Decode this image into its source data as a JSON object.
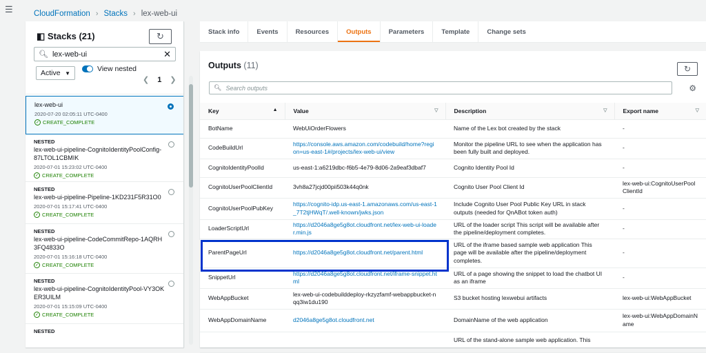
{
  "breadcrumb": [
    "CloudFormation",
    "Stacks",
    "lex-web-ui"
  ],
  "stacks_panel": {
    "title": "Stacks",
    "count": "(21)",
    "search_value": "lex-web-ui",
    "filter_value": "Active",
    "view_nested_label": "View nested",
    "page": "1",
    "items": [
      {
        "nested": "",
        "name": "lex-web-ui",
        "date": "2020-07-20 02:05:11 UTC-0400",
        "status": "CREATE_COMPLETE",
        "selected": true
      },
      {
        "nested": "NESTED",
        "name": "lex-web-ui-pipeline-CognitoIdentityPoolConfig-87LTOL1CBMIK",
        "date": "2020-07-01 15:23:02 UTC-0400",
        "status": "CREATE_COMPLETE",
        "selected": false
      },
      {
        "nested": "NESTED",
        "name": "lex-web-ui-pipeline-Pipeline-1KD231F5R31O0",
        "date": "2020-07-01 15:17:41 UTC-0400",
        "status": "CREATE_COMPLETE",
        "selected": false
      },
      {
        "nested": "NESTED",
        "name": "lex-web-ui-pipeline-CodeCommitRepo-1AQRH3FQ4833O",
        "date": "2020-07-01 15:16:18 UTC-0400",
        "status": "CREATE_COMPLETE",
        "selected": false
      },
      {
        "nested": "NESTED",
        "name": "lex-web-ui-pipeline-CognitoIdentityPool-VY3OKER3UILM",
        "date": "2020-07-01 15:15:09 UTC-0400",
        "status": "CREATE_COMPLETE",
        "selected": false
      },
      {
        "nested": "NESTED",
        "name": "",
        "date": "",
        "status": "",
        "selected": false
      }
    ]
  },
  "tabs": [
    {
      "label": "Stack info",
      "active": false
    },
    {
      "label": "Events",
      "active": false
    },
    {
      "label": "Resources",
      "active": false
    },
    {
      "label": "Outputs",
      "active": true
    },
    {
      "label": "Parameters",
      "active": false
    },
    {
      "label": "Template",
      "active": false
    },
    {
      "label": "Change sets",
      "active": false
    }
  ],
  "outputs": {
    "title": "Outputs",
    "count": "(11)",
    "search_placeholder": "Search outputs",
    "columns": [
      "Key",
      "Value",
      "Description",
      "Export name"
    ],
    "rows": [
      {
        "key": "BotName",
        "value": "WebUiOrderFlowers",
        "link": false,
        "description": "Name of the Lex bot created by the stack",
        "export": "-"
      },
      {
        "key": "CodeBuildUrl",
        "value": "https://console.aws.amazon.com/codebuild/home?region=us-east-1#/projects/lex-web-ui/view",
        "link": true,
        "description": "Monitor the pipeline URL to see when the application has been fully built and deployed.",
        "export": "-"
      },
      {
        "key": "CognitoIdentityPoolId",
        "value": "us-east-1:a6219dbc-f6b5-4e79-8d06-2a9eaf3dbaf7",
        "link": false,
        "description": "Cognito Identity Pool Id",
        "export": "-"
      },
      {
        "key": "CognitoUserPoolClientId",
        "value": "3vh8a27jcjd00pii503k44q0nk",
        "link": false,
        "description": "Cognito User Pool Client Id",
        "export": "lex-web-ui:CognitoUserPoolClientId"
      },
      {
        "key": "CognitoUserPoolPubKey",
        "value": "https://cognito-idp.us-east-1.amazonaws.com/us-east-1_7T2tjHWqT/.well-known/jwks.json",
        "link": true,
        "description": "Include Cognito User Pool Public Key URL in stack outputs (needed for QnABot token auth)",
        "export": "-"
      },
      {
        "key": "LoaderScriptUrl",
        "value": "https://d2046a8ge5g8ot.cloudfront.net/lex-web-ui-loader.min.js",
        "link": true,
        "description": "URL of the loader script This script will be available after the pipeline/deployment completes.",
        "export": "-"
      },
      {
        "key": "ParentPageUrl",
        "value": "https://d2046a8ge5g8ot.cloudfront.net/parent.html",
        "link": true,
        "description": "URL of the iframe based sample web application This page will be available after the pipeline/deployment completes.",
        "export": "-"
      },
      {
        "key": "SnippetUrl",
        "value": "https://d2046a8ge5g8ot.cloudfront.net/iframe-snippet.html",
        "link": true,
        "description": "URL of a page showing the snippet to load the chatbot UI as an iframe",
        "export": "-"
      },
      {
        "key": "WebAppBucket",
        "value": "lex-web-ui-codebuilddeploy-rkzyzfamf-webappbucket-nqq3iw1du190",
        "link": false,
        "description": "S3 bucket hosting lexwebui artifacts",
        "export": "lex-web-ui:WebAppBucket"
      },
      {
        "key": "WebAppDomainName",
        "value": "d2046a8ge5g8ot.cloudfront.net",
        "link": true,
        "description": "DomainName of the web application",
        "export": "lex-web-ui:WebAppDomainName"
      },
      {
        "key": "",
        "value": "",
        "link": false,
        "description": "URL of the stand-alone sample web application. This",
        "export": ""
      }
    ]
  },
  "colors": {
    "accent": "#ec7211",
    "link": "#0073bb",
    "success": "#1d8102",
    "highlight": "#0033cc"
  }
}
